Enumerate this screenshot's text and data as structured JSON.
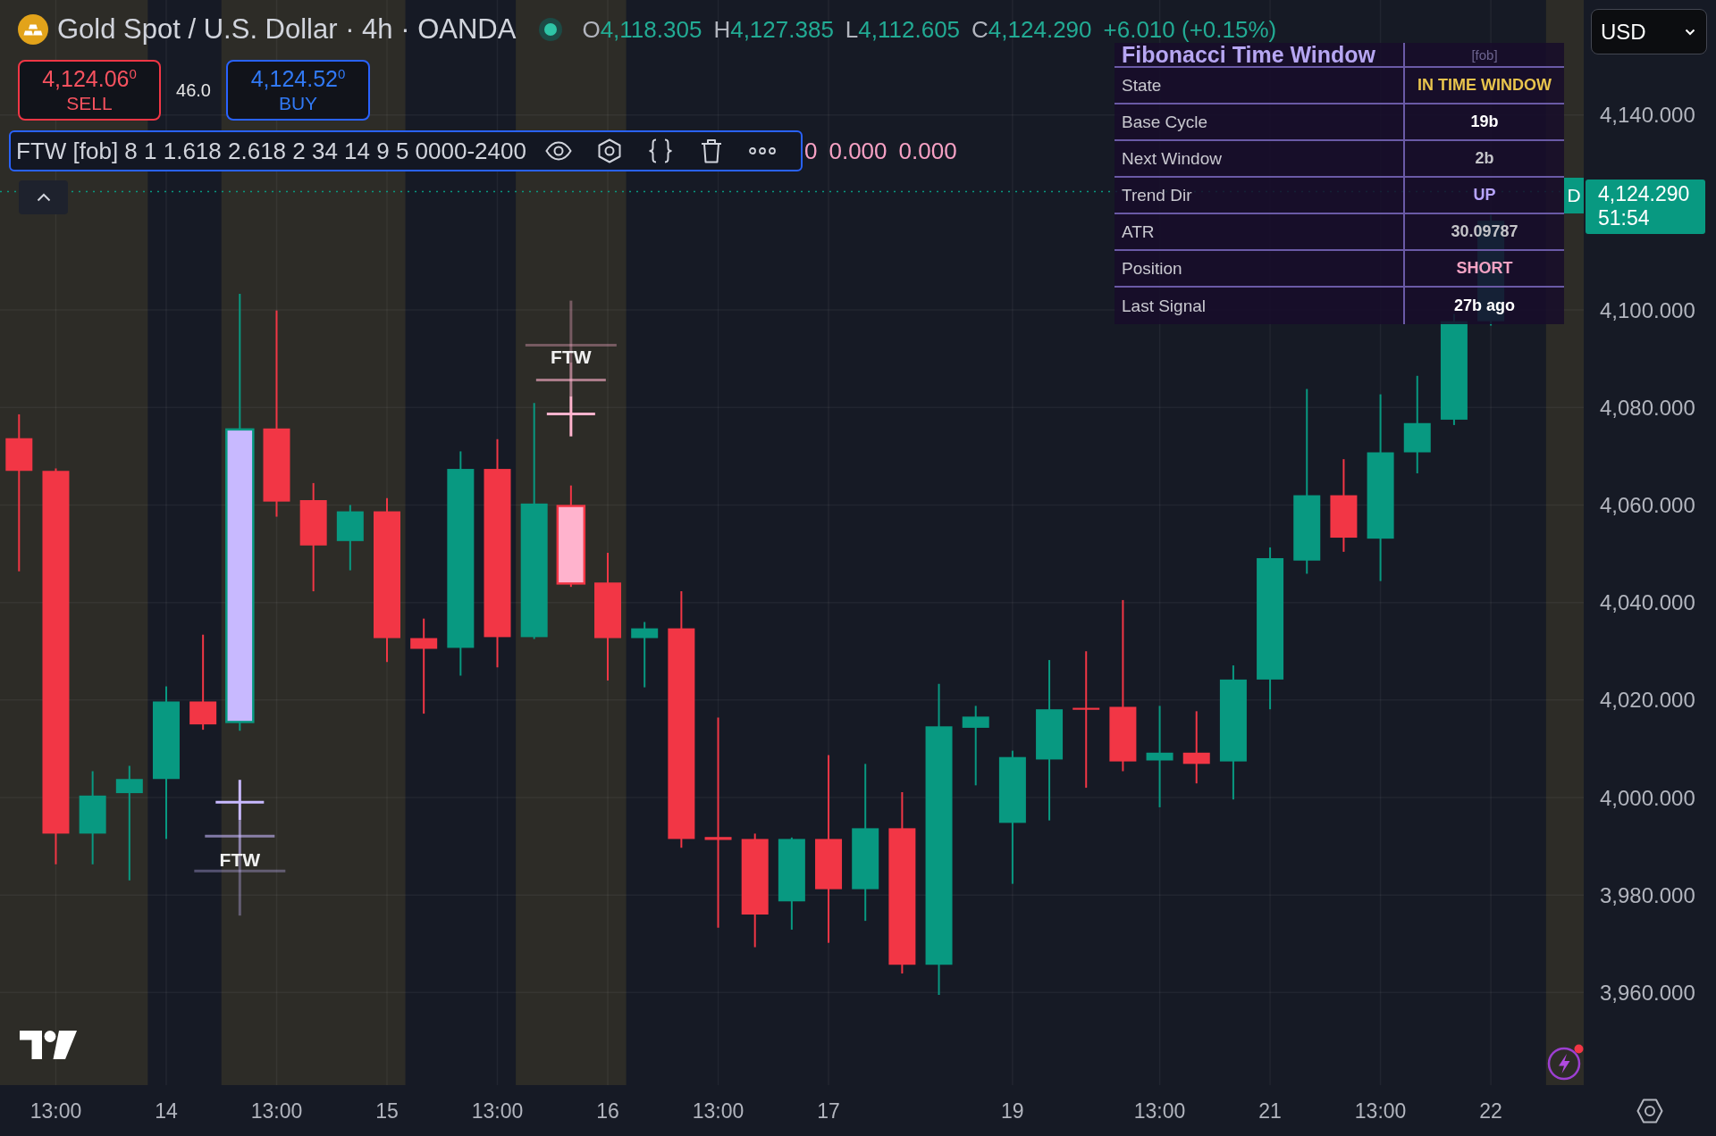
{
  "header": {
    "symbol": "Gold Spot / U.S. Dollar · 4h · OANDA",
    "ohlc": [
      {
        "label": "O",
        "value": "4,118.305"
      },
      {
        "label": "H",
        "value": "4,127.385"
      },
      {
        "label": "L",
        "value": "4,112.605"
      },
      {
        "label": "C",
        "value": "4,124.290"
      }
    ],
    "change": "+6.010 (+0.15%)"
  },
  "trade_panel": {
    "sell": {
      "price": "4,124.06$^{0}$",
      "label": "SELL"
    },
    "spread": "46.0",
    "buy": {
      "price": "4,124.52$^{0}$",
      "label": "BUY"
    }
  },
  "indicator_legend": {
    "text": "FTW [fob] 8 1 1.618 2.618 2 34 14 9 5 0000-2400",
    "values": [
      "0",
      "0.000",
      "0.000"
    ]
  },
  "info_table": {
    "title": "Fibonacci Time Window",
    "tag": "[fob]",
    "rows": [
      {
        "label": "State",
        "value": "IN TIME WINDOW",
        "color": "#e8c44d"
      },
      {
        "label": "Base Cycle",
        "value": "19b",
        "color": "#ffffff"
      },
      {
        "label": "Next Window",
        "value": "2b",
        "color": "#c4c4c8"
      },
      {
        "label": "Trend Dir",
        "value": "UP",
        "color": "#b7a4ff"
      },
      {
        "label": "ATR",
        "value": "30.09787",
        "color": "#c4c4c8"
      },
      {
        "label": "Position",
        "value": "SHORT",
        "color": "#f4a3c4"
      },
      {
        "label": "Last Signal",
        "value": "27b ago",
        "color": "#ffffff"
      }
    ]
  },
  "currency_select": {
    "value": "USD"
  },
  "chart": {
    "signals": [
      {
        "label": "FTW",
        "color": "#c8b9ff"
      },
      {
        "label": "FTW",
        "color": "#ffb3cd"
      }
    ],
    "symbol_label": "D",
    "price_tag": {
      "price": "4,124.290",
      "countdown": "51:54"
    },
    "price_axis": {
      "labels": [
        "4,140.000",
        "4,100.000",
        "4,080.000",
        "4,060.000",
        "4,040.000",
        "4,020.000",
        "4,000.000",
        "3,980.000",
        "3,960.000"
      ]
    },
    "time_axis": {
      "labels": [
        "13:00",
        "14",
        "13:00",
        "15",
        "13:00",
        "16",
        "13:00",
        "17",
        "19",
        "13:00",
        "21",
        "13:00",
        "22"
      ]
    }
  }
}
